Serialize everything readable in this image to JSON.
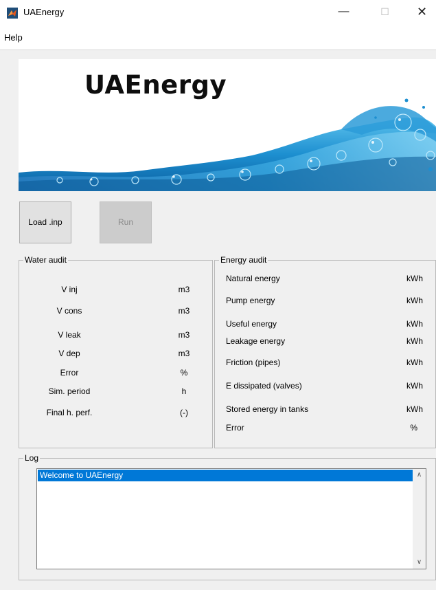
{
  "window": {
    "title": "UAEnergy",
    "controls": {
      "minimize": "—",
      "maximize": "☐",
      "close": "✕"
    }
  },
  "menu": {
    "help": "Help"
  },
  "banner": {
    "title": "UAEnergy"
  },
  "buttons": {
    "load": "Load .inp",
    "run": "Run"
  },
  "water_audit": {
    "legend": "Water audit",
    "rows": [
      {
        "label": "V inj",
        "unit": "m3"
      },
      {
        "label": "V cons",
        "unit": "m3"
      },
      {
        "label": "V leak",
        "unit": "m3"
      },
      {
        "label": "V dep",
        "unit": "m3"
      },
      {
        "label": "Error",
        "unit": "%"
      },
      {
        "label": "Sim. period",
        "unit": "h"
      },
      {
        "label": "Final h. perf.",
        "unit": "(-)"
      }
    ]
  },
  "energy_audit": {
    "legend": "Energy audit",
    "rows": [
      {
        "label": "Natural energy",
        "unit": "kWh"
      },
      {
        "label": "Pump energy",
        "unit": "kWh"
      },
      {
        "label": "Useful energy",
        "unit": "kWh"
      },
      {
        "label": "Leakage energy",
        "unit": "kWh"
      },
      {
        "label": "Friction (pipes)",
        "unit": "kWh"
      },
      {
        "label": "E dissipated (valves)",
        "unit": "kWh"
      },
      {
        "label": "Stored energy in tanks",
        "unit": "kWh"
      },
      {
        "label": "Error",
        "unit": "%"
      }
    ]
  },
  "log": {
    "legend": "Log",
    "items": [
      "Welcome to UAEnergy"
    ]
  },
  "icons": {
    "app": "matlab-icon",
    "scroll_up": "chevron-up-icon",
    "scroll_down": "chevron-down-icon"
  },
  "colors": {
    "selection": "#0078d7",
    "window_bg": "#f0f0f0",
    "water": "#1d8fd0"
  }
}
